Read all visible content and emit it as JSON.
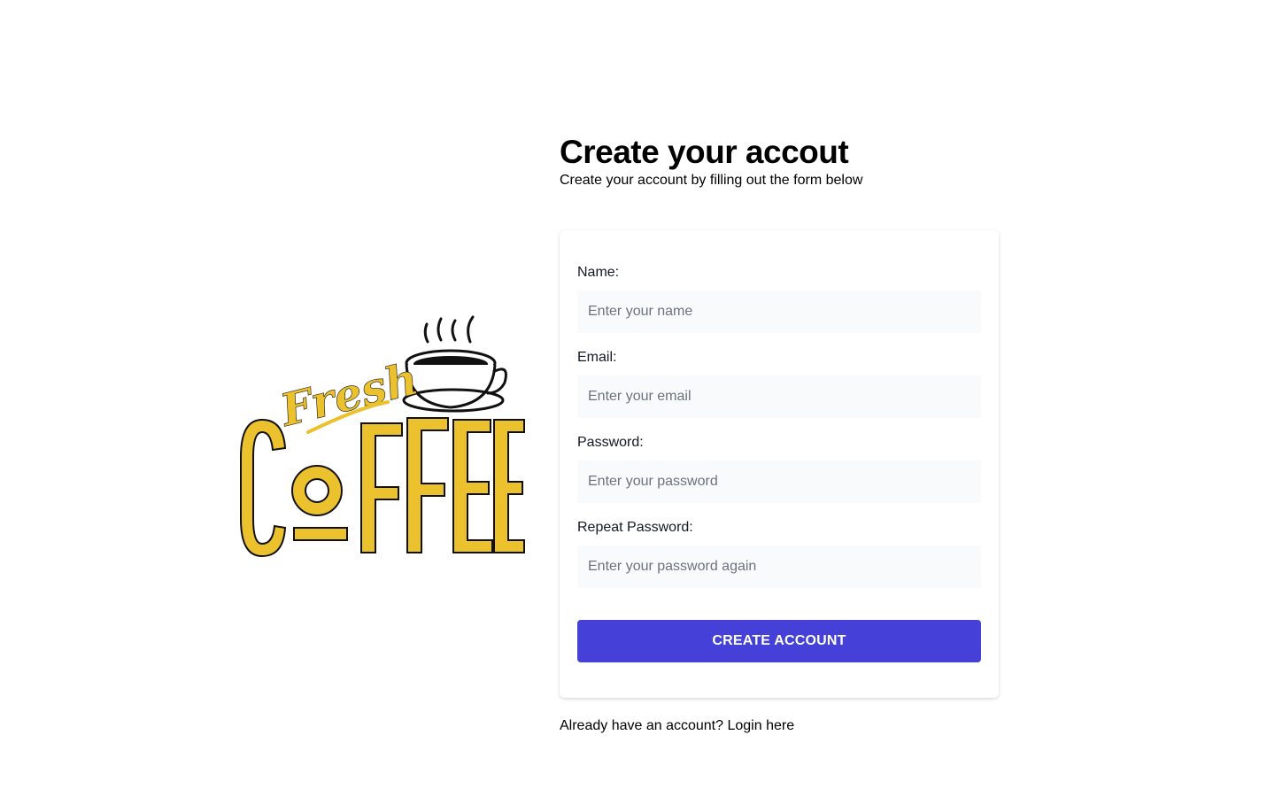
{
  "logo": {
    "icon": "fresh-coffee-logo",
    "script_text": "Fresh",
    "main_text": "COFFEE",
    "brand_color": "#ebc12e"
  },
  "header": {
    "title": "Create your accout",
    "subtitle": "Create your account by filling out the form below"
  },
  "form": {
    "fields": [
      {
        "label": "Name:",
        "placeholder": "Enter your name",
        "value": ""
      },
      {
        "label": "Email:",
        "placeholder": "Enter your email",
        "value": ""
      },
      {
        "label": "Password:",
        "placeholder": "Enter your password",
        "value": ""
      },
      {
        "label": "Repeat Password:",
        "placeholder": "Enter your password again",
        "value": ""
      }
    ],
    "submit_label": "CREATE ACCOUNT",
    "accent_color": "#4540d8"
  },
  "footer": {
    "prompt": "Already have an account?",
    "link_label": "Login here"
  }
}
